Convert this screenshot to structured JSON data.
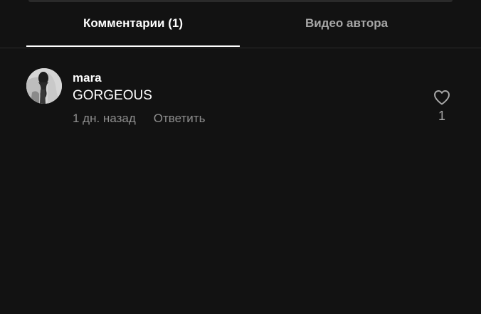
{
  "tabs": [
    {
      "label": "Комментарии (1)",
      "active": true
    },
    {
      "label": "Видео автора",
      "active": false
    }
  ],
  "comments": [
    {
      "username": "mara",
      "text": "GORGEOUS",
      "time": "1 дн. назад",
      "reply_label": "Ответить",
      "likes": "1",
      "avatar_icon": "user-avatar-photo",
      "like_icon": "heart-outline-icon"
    }
  ],
  "colors": {
    "background": "#121212",
    "text_primary": "#ffffff",
    "text_secondary": "#8e8e8e",
    "divider": "#2b2b2b"
  }
}
